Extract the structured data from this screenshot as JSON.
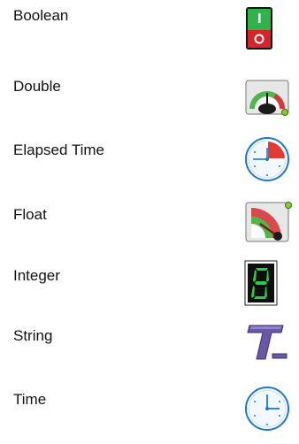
{
  "types": [
    {
      "label": "Boolean",
      "icon": "toggle-switch-icon"
    },
    {
      "label": "Double",
      "icon": "gauge-meter-icon"
    },
    {
      "label": "Elapsed Time",
      "icon": "stopwatch-clock-icon"
    },
    {
      "label": "Float",
      "icon": "angled-gauge-icon"
    },
    {
      "label": "Integer",
      "icon": "digital-digit-icon"
    },
    {
      "label": "String",
      "icon": "text-t-icon"
    },
    {
      "label": "Time",
      "icon": "clock-icon"
    }
  ],
  "colors": {
    "text": "#111111",
    "toggle_green": "#2fb44b",
    "toggle_red": "#d8232a",
    "gauge_green": "#4fb748",
    "gauge_red": "#d7363a",
    "digit_green": "#21d04a",
    "string_purple": "#6b57a8",
    "clock_blue": "#1f78c7"
  }
}
